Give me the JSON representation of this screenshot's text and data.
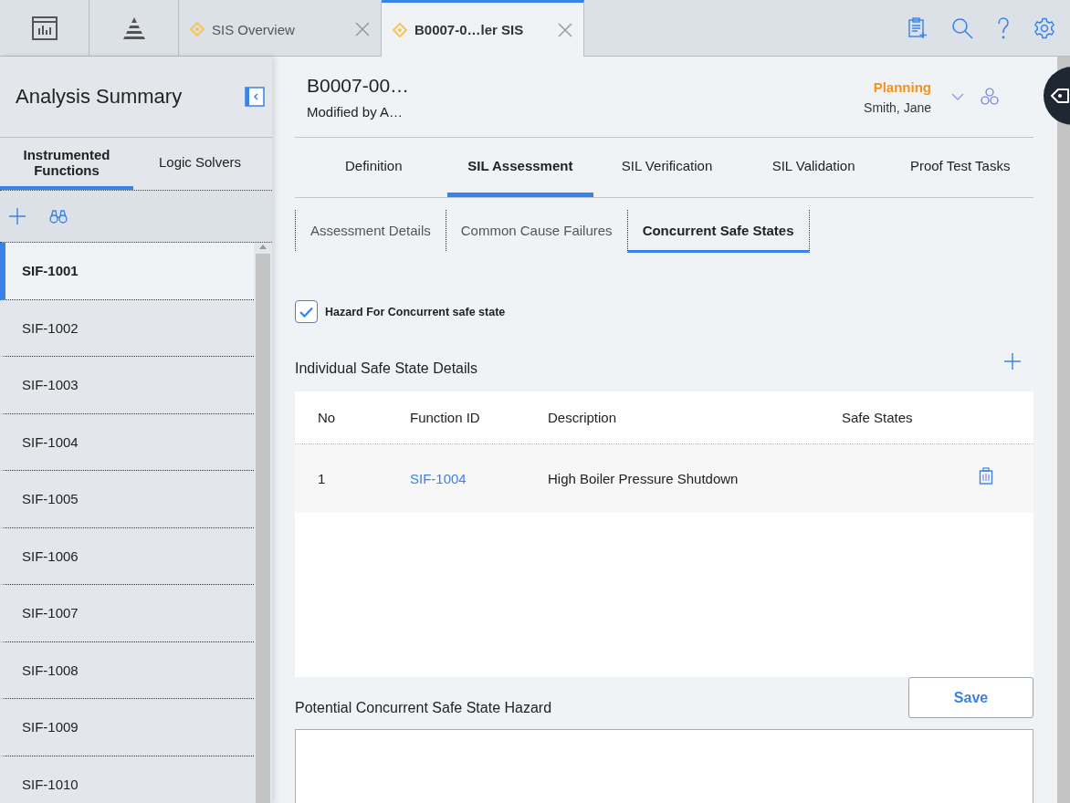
{
  "top_bar": {
    "tabs": [
      {
        "label": "SIS Overview",
        "selected": false
      },
      {
        "label": "B0007-0…ler SIS",
        "selected": true
      }
    ]
  },
  "sidebar": {
    "title": "Analysis Summary",
    "tabs": [
      {
        "label": "Instrumented Functions",
        "selected": true
      },
      {
        "label": "Logic Solvers",
        "selected": false
      }
    ],
    "items": [
      {
        "label": "SIF-1001",
        "selected": true
      },
      {
        "label": "SIF-1002",
        "selected": false
      },
      {
        "label": "SIF-1003",
        "selected": false
      },
      {
        "label": "SIF-1004",
        "selected": false
      },
      {
        "label": "SIF-1005",
        "selected": false
      },
      {
        "label": "SIF-1006",
        "selected": false
      },
      {
        "label": "SIF-1007",
        "selected": false
      },
      {
        "label": "SIF-1008",
        "selected": false
      },
      {
        "label": "SIF-1009",
        "selected": false
      },
      {
        "label": "SIF-1010",
        "selected": false
      }
    ]
  },
  "header": {
    "title": "B0007-00…",
    "subtitle": "Modified by A…",
    "state": "Planning",
    "owner": "Smith, Jane"
  },
  "tabs": [
    {
      "label": "Definition",
      "selected": false
    },
    {
      "label": "SIL Assessment",
      "selected": true
    },
    {
      "label": "SIL Verification",
      "selected": false
    },
    {
      "label": "SIL Validation",
      "selected": false
    },
    {
      "label": "Proof Test Tasks",
      "selected": false
    }
  ],
  "subtabs": [
    {
      "label": "Assessment Details",
      "selected": false
    },
    {
      "label": "Common Cause Failures",
      "selected": false
    },
    {
      "label": "Concurrent Safe States",
      "selected": true
    }
  ],
  "hazard_checkbox": {
    "label": "Hazard For Concurrent safe state",
    "checked": true
  },
  "section_title": "Individual Safe State Details",
  "table": {
    "columns": [
      "No",
      "Function ID",
      "Description",
      "Safe States"
    ],
    "rows": [
      {
        "no": "1",
        "function_id": "SIF-1004",
        "description": "High Boiler Pressure Shutdown"
      }
    ]
  },
  "save_button": "Save",
  "hazard_label": "Potential Concurrent Safe State Hazard"
}
